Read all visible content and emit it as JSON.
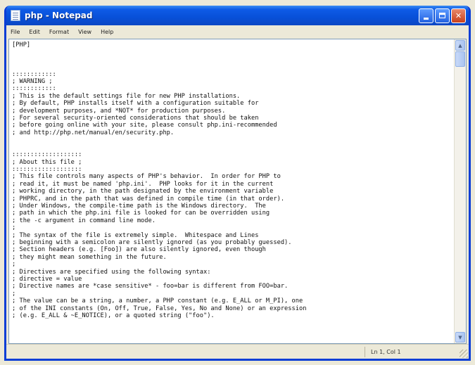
{
  "window": {
    "title": "php - Notepad"
  },
  "menu": [
    "File",
    "Edit",
    "Format",
    "View",
    "Help"
  ],
  "document": {
    "text": "[PHP]\n\n\n\n::::::::::::\n; WARNING ;\n::::::::::::\n; This is the default settings file for new PHP installations.\n; By default, PHP installs itself with a configuration suitable for\n; development purposes, and *NOT* for production purposes.\n; For several security-oriented considerations that should be taken\n; before going online with your site, please consult php.ini-recommended\n; and http://php.net/manual/en/security.php.\n\n\n:::::::::::::::::::\n; About this file ;\n:::::::::::::::::::\n; This file controls many aspects of PHP's behavior.  In order for PHP to\n; read it, it must be named 'php.ini'.  PHP looks for it in the current\n; working directory, in the path designated by the environment variable\n; PHPRC, and in the path that was defined in compile time (in that order).\n; Under Windows, the compile-time path is the Windows directory.  The\n; path in which the php.ini file is looked for can be overridden using\n; the -c argument in command line mode.\n;\n; The syntax of the file is extremely simple.  Whitespace and Lines\n; beginning with a semicolon are silently ignored (as you probably guessed).\n; Section headers (e.g. [Foo]) are also silently ignored, even though\n; they might mean something in the future.\n;\n; Directives are specified using the following syntax:\n; directive = value\n; Directive names are *case sensitive* - foo=bar is different from FOO=bar.\n;\n; The value can be a string, a number, a PHP constant (e.g. E_ALL or M_PI), one\n; of the INI constants (On, Off, True, False, Yes, No and None) or an expression\n; (e.g. E_ALL & ~E_NOTICE), or a quoted string (\"foo\")."
  },
  "status": {
    "position": "Ln 1, Col 1"
  },
  "icons": {
    "app": "notepad-icon",
    "minimize": "minimize-icon",
    "maximize": "maximize-icon",
    "close": "close-icon",
    "scroll_up": "scroll-up-arrow-icon",
    "scroll_down": "scroll-down-arrow-icon",
    "resize": "resize-grip-icon"
  },
  "colors": {
    "titlebar": "#0850d8",
    "close_button": "#c9401b",
    "window_face": "#ece9d8"
  }
}
